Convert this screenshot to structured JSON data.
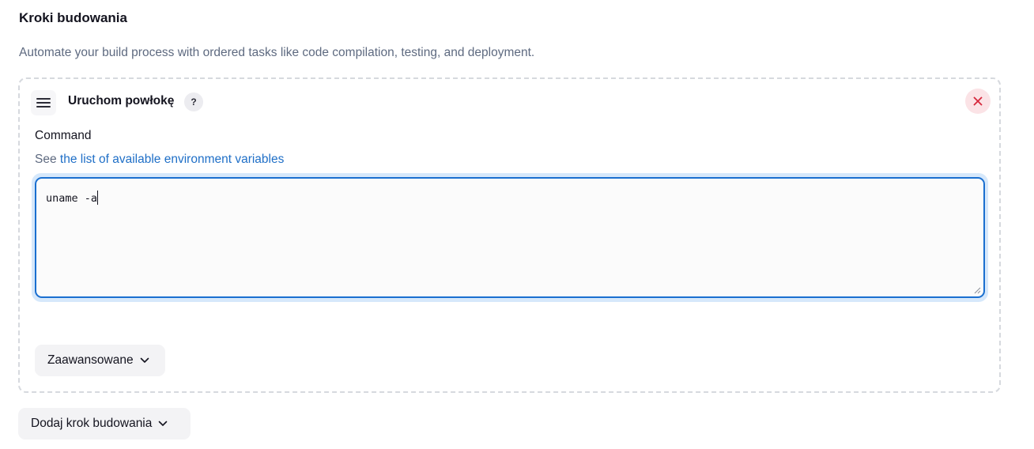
{
  "section": {
    "title": "Kroki budowania",
    "description": "Automate your build process with ordered tasks like code compilation, testing, and deployment."
  },
  "step": {
    "title": "Uruchom powłokę",
    "help_label": "?",
    "close_icon": "close-icon",
    "drag_icon": "drag-handle-icon",
    "command_label": "Command",
    "env_hint_prefix": "See",
    "env_hint_link": "the list of available environment variables",
    "command_value": "uname -a",
    "advanced_label": "Zaawansowane"
  },
  "add_step": {
    "label": "Dodaj krok budowania"
  },
  "colors": {
    "accent": "#1a6fd0",
    "link": "#1f6fc7",
    "danger": "#d6293d",
    "danger_bg": "#fbe3e6"
  }
}
